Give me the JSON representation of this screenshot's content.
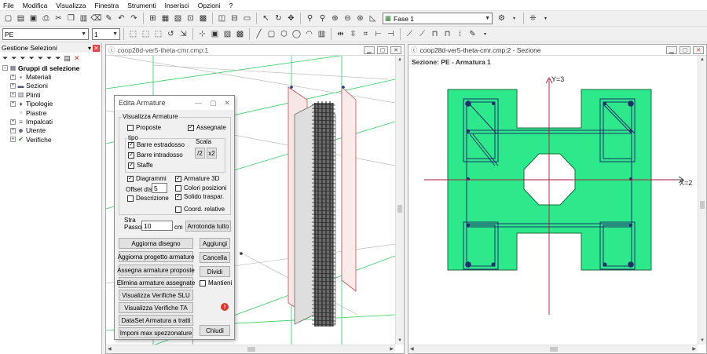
{
  "menu": [
    "File",
    "Modifica",
    "Visualizza",
    "Finestra",
    "Strumenti",
    "Inserisci",
    "Opzioni",
    "?"
  ],
  "toolbar1": {
    "fase_value": "Fase 1"
  },
  "toolbar2": {
    "pe_value": "PE",
    "num_value": "1"
  },
  "left_panel": {
    "title": "Gestione Selezioni",
    "tree": [
      {
        "label": "Gruppi di selezione",
        "root": true
      },
      {
        "label": "Materiali"
      },
      {
        "label": "Sezioni"
      },
      {
        "label": "Plinti"
      },
      {
        "label": "Tipologie"
      },
      {
        "label": "Piastre"
      },
      {
        "label": "Impalcati"
      },
      {
        "label": "Utente"
      },
      {
        "label": "Verifiche"
      }
    ]
  },
  "window1": {
    "title": "coop28d-ver5-theta-cmr.cmp:1"
  },
  "window2": {
    "title": "coop28d-ver5-theta-cmr.cmp:2 - Sezione",
    "section_label": "Sezione: PE - Armatura 1",
    "axis_y": "Y=3",
    "axis_x": "X=2"
  },
  "dialog": {
    "title": "Edita Armature",
    "visualizza_label": "Visualizza Armature",
    "proposte": "Proposte",
    "assegnate": "Assegnate",
    "tipo": "tipo",
    "barre_estradosso": "Barre estradosso",
    "barre_intradosso": "Barre intradosso",
    "staffe": "Staffe",
    "scala": "Scala",
    "div2": "/2",
    "mul2": "x2",
    "diagrammi": "Diagrammi",
    "armature_3d": "Armature 3D",
    "offset_dis": "Offset dis.",
    "offset_value": "5",
    "colori_posizioni": "Colori posizioni",
    "solido_traspar": "Solido traspar.",
    "descrizione": "Descrizione",
    "coord_relative": "Coord. relative",
    "stra": "Stra",
    "passo": "Passo",
    "passo_value": "10",
    "cm": "cm",
    "arrotonda_tutto": "Arrotonda tutto",
    "aggiorna_disegno": "Aggiorna disegno",
    "aggiungi": "Aggiungi",
    "aggiorna_progetto": "Aggiorna progetto armature",
    "cancella": "Cancella",
    "assegna_proposte": "Assegna armature proposte",
    "dividi": "Dividi",
    "elimina_assegnate": "Elimina armature assegnate",
    "mantieni": "Mantieni",
    "verifiche_slu": "Visualizza Verifiche SLU",
    "verifiche_ta": "Visualizza Verifiche TA",
    "dataset": "DataSet Armatura a tratti",
    "imponi": "Imponi max spezzonature",
    "chiudi": "Chiudi"
  },
  "colors": {
    "section_fill": "#2ee88c",
    "section_stroke": "#1b6b3a",
    "rebar": "#1f2f6b",
    "grid": "#22c25a"
  }
}
